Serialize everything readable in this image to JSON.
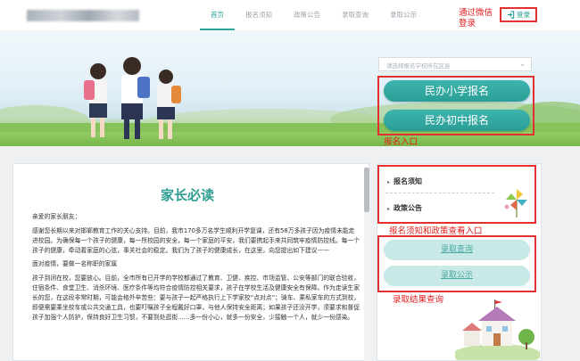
{
  "header": {
    "nav": [
      "首页",
      "报名须知",
      "政策公告",
      "录取查询",
      "录取公示"
    ],
    "active_nav": "首页",
    "login_label": "登录"
  },
  "annotations": {
    "wechat_login": [
      "通过微信",
      "登录"
    ],
    "entry": "报名入口",
    "notice_policy": "报名须知和政策查看入口",
    "result": "录取结果查询"
  },
  "banner": {
    "select_placeholder": "请选择报名学校所在区县",
    "btn_primary": "民办小学报名",
    "btn_middle": "民办初中报名"
  },
  "notice": {
    "title": "家长必读",
    "paragraphs": [
      "亲爱的家长朋友：",
      "感谢您长期以来对邯郸教育工作的关心支持。目前，我市170多万名学生顺利开学复课，还有58万多孩子因为疫情未能走进校园。为确保每一个孩子的健康，每一所校园的安全，每一个家庭的平安，我们要携起手来共同筑牢疫情防控线。每一个孩子的健康，牵动着家庭的心弦，事关社会的稳定。我们为了孩子的健康成长，在这里，向您提出如下建议——",
      "面对疫情，要做一名称职的家属",
      "孩子到闭在校，您要放心。目前，全市所有已开学的学校都通过了教育、卫健、疾控、市场监管、公安等部门的联合验收，住宿条件、食堂卫生、消杀环境、医疗条件等均符合疫情防控相关要求，孩子在学校生活及健康安全有保障。作为走读生家长的您，在这段非常时期，可能会格外辛苦些：要与孩子一起严格执行上下学家校“点对点”；骑车、乘私家车的方式到校，即便需要乘坐校车或公共交通工具，也要叮嘱孩子全程戴好口罩，与他人保持安全距离；如果孩子还没开学，须要求和督促孩子加强个人防护，保持良好卫生习惯，不要到处逛街……多一份小心，就多一份安全，少接触一个人，就少一份感染。"
    ]
  },
  "side": {
    "link_notice": "报名须知",
    "link_policy": "政策公告",
    "btn_query": "录取查询",
    "btn_publicity": "录取公示"
  },
  "colors": {
    "accent": "#2aa79b",
    "annotation": "#e21c1c"
  }
}
